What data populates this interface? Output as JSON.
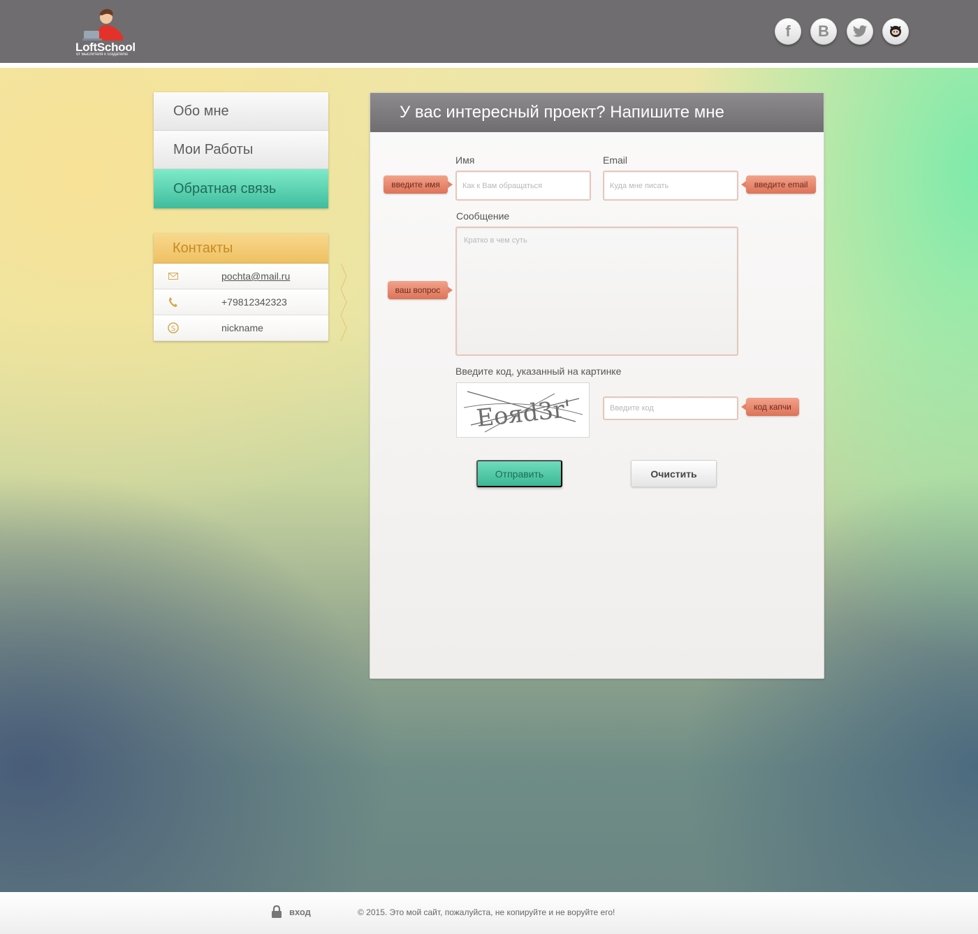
{
  "header": {
    "brand": "LoftSchool",
    "tagline": "от мыслителя к создателю",
    "social": [
      {
        "icon": "facebook-icon",
        "glyph": "f"
      },
      {
        "icon": "vk-icon",
        "glyph": "B"
      },
      {
        "icon": "twitter-icon",
        "glyph": ""
      },
      {
        "icon": "github-icon",
        "glyph": ""
      }
    ]
  },
  "nav": {
    "items": [
      {
        "label": "Обо мне"
      },
      {
        "label": "Мои Работы"
      },
      {
        "label": "Обратная связь",
        "active": true
      }
    ]
  },
  "contacts": {
    "title": "Контакты",
    "email": "pochta@mail.ru",
    "phone": "+79812342323",
    "skype": "nickname"
  },
  "form": {
    "title": "У вас интересный проект? Напишите мне",
    "name_label": "Имя",
    "name_placeholder": "Как к Вам обращаться",
    "name_tip": "введите имя",
    "email_label": "Email",
    "email_placeholder": "Куда мне писать",
    "email_tip": "введите email",
    "message_label": "Сообщение",
    "message_placeholder": "Кратко в чем суть",
    "message_tip": "ваш вопрос",
    "captcha_label": "Введите код, указанный на картинке",
    "captcha_text": "Eoяd3r'",
    "captcha_placeholder": "Введите код",
    "captcha_tip": "код капчи",
    "submit_label": "Отправить",
    "clear_label": "Очистить"
  },
  "footer": {
    "login_label": "вход",
    "copyright": "© 2015. Это мой сайт, пожалуйста, не копируйте и не воруйте его!"
  },
  "colors": {
    "header_bg": "#6f6d6f",
    "accent_green": "#3fbd9d",
    "accent_orange": "#efc063",
    "tip_red": "#dd7358"
  }
}
